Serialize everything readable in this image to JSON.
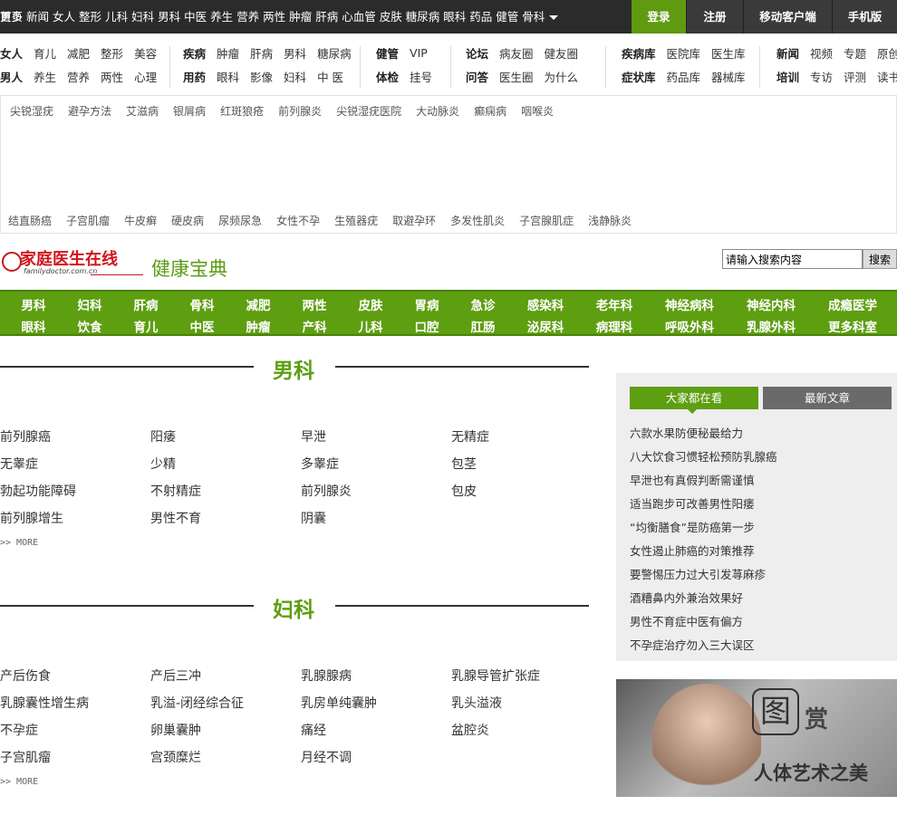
{
  "topbar": {
    "nav": [
      "首页",
      "新闻",
      "女人",
      "整形",
      "儿科",
      "妇科",
      "男科",
      "中医",
      "养生",
      "营养",
      "两性",
      "肿瘤",
      "肝病",
      "心血管",
      "皮肤",
      "糖尿病",
      "眼科",
      "药品",
      "健管",
      "骨科"
    ],
    "more": "更多",
    "login": "登录",
    "register": "注册",
    "mobile_client": "移动客户端",
    "mobile_version": "手机版"
  },
  "subnav": {
    "g1": {
      "row1": [
        "女人",
        "育儿",
        "减肥",
        "整形",
        "美容"
      ],
      "row2": [
        "男人",
        "养生",
        "营养",
        "两性",
        "心理"
      ]
    },
    "g2": {
      "row1": [
        "疾病",
        "肿瘤",
        "肝病",
        "男科",
        "糖尿病"
      ],
      "row2": [
        "用药",
        "眼科",
        "影像",
        "妇科",
        "中 医"
      ]
    },
    "g3": {
      "row1": [
        "健管",
        "VIP"
      ],
      "row2": [
        "体检",
        "挂号"
      ]
    },
    "g4": {
      "row1": [
        "论坛",
        "病友圈",
        "健友圈"
      ],
      "row2": [
        "问答",
        "医生圈",
        "为什么"
      ]
    },
    "g5": {
      "row1": [
        "疾病库",
        "医院库",
        "医生库"
      ],
      "row2": [
        "症状库",
        "药品库",
        "器械库"
      ]
    },
    "g6": {
      "row1": [
        "新闻",
        "视频",
        "专题",
        "原创"
      ],
      "row2": [
        "培训",
        "专访",
        "评测",
        "读书"
      ]
    }
  },
  "tags": {
    "row1": [
      "尖锐湿疣",
      "避孕方法",
      "艾滋病",
      "银屑病",
      "红斑狼疮",
      "前列腺炎",
      "尖锐湿疣医院",
      "大动脉炎",
      "癫痫病",
      "咽喉炎"
    ],
    "row2": [
      "结直肠癌",
      "子宫肌瘤",
      "牛皮癣",
      "硬皮病",
      "尿频尿急",
      "女性不孕",
      "生殖器疣",
      "取避孕环",
      "多发性肌炎",
      "子宫腺肌症",
      "浅静脉炎"
    ]
  },
  "logo": {
    "text": "家庭医生在线",
    "sub": "familydoctor.com.cn"
  },
  "site_title": "健康宝典",
  "search": {
    "placeholder": "请输入搜索内容",
    "button": "搜索"
  },
  "greennav": {
    "row1": [
      "男科",
      "妇科",
      "肝病",
      "骨科",
      "减肥",
      "两性",
      "皮肤",
      "胃病",
      "急诊",
      "感染科",
      "老年科",
      "神经病科",
      "神经内科",
      "成瘾医学"
    ],
    "row2": [
      "眼科",
      "饮食",
      "育儿",
      "中医",
      "肿瘤",
      "产科",
      "儿科",
      "口腔",
      "肛肠",
      "泌尿科",
      "病理科",
      "呼吸外科",
      "乳腺外科",
      "更多科室"
    ]
  },
  "sections": [
    {
      "title": "男科",
      "items": [
        "前列腺癌",
        "阳痿",
        "早泄",
        "无精症",
        "无睾症",
        "少精",
        "多睾症",
        "包茎",
        "勃起功能障碍",
        "不射精症",
        "前列腺炎",
        "包皮",
        "前列腺增生",
        "男性不育",
        "阴囊"
      ],
      "more": ">> MORE"
    },
    {
      "title": "妇科",
      "items": [
        "产后伤食",
        "产后三冲",
        "乳腺腺病",
        "乳腺导管扩张症",
        "乳腺囊性增生病",
        "乳溢-闭经综合征",
        "乳房单纯囊肿",
        "乳头溢液",
        "不孕症",
        "卵巢囊肿",
        "痛经",
        "盆腔炎",
        "子宫肌瘤",
        "宫颈糜烂",
        "月经不调"
      ],
      "more": ">> MORE"
    }
  ],
  "rightpanel": {
    "tab_active": "大家都在看",
    "tab_inactive": "最新文章",
    "items": [
      "六款水果防便秘最给力",
      "八大饮食习惯轻松预防乳腺癌",
      "早泄也有真假判断需谨慎",
      "适当跑步可改善男性阳痿",
      "“均衡膳食”是防癌第一步",
      "女性遏止肺癌的对策推荐",
      "要警惕压力过大引发荨麻疹",
      "酒糟鼻内外兼治效果好",
      "男性不育症中医有偏方",
      "不孕症治疗勿入三大误区"
    ]
  },
  "ad": {
    "glyph": "图",
    "word": "赏",
    "caption": "人体艺术之美"
  }
}
